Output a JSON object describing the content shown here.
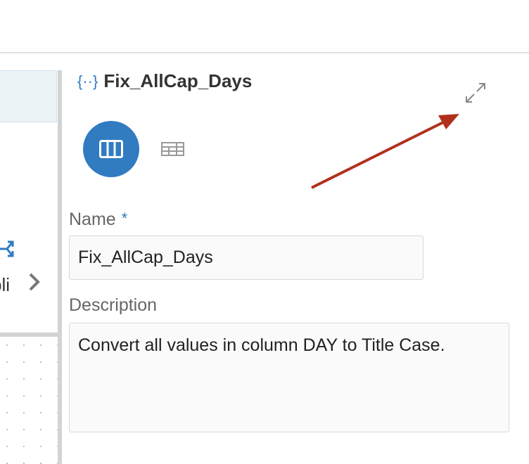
{
  "header": {
    "title": "Fix_AllCap_Days"
  },
  "left_panel": {
    "truncated_text": "pli"
  },
  "form": {
    "name_label": "Name",
    "required_marker": "*",
    "name_value": "Fix_AllCap_Days",
    "description_label": "Description",
    "description_value": "Convert all values in column DAY to Title Case."
  },
  "colors": {
    "accent": "#317bc1",
    "annotation_arrow": "#b0301c"
  }
}
